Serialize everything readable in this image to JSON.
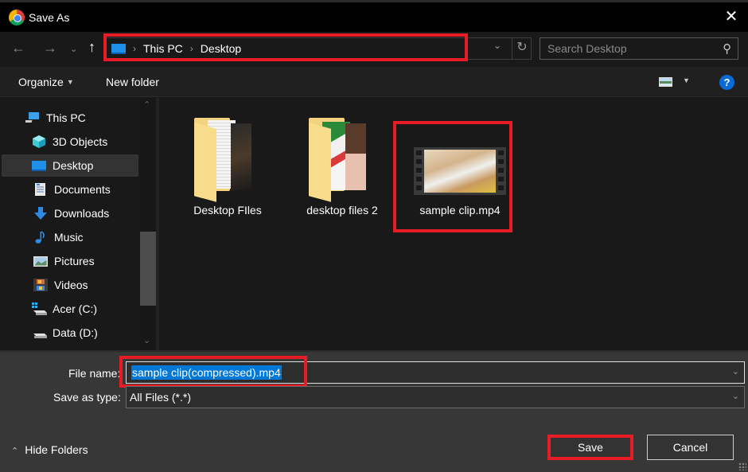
{
  "window": {
    "title": "Save As",
    "app_icon": "chrome-icon",
    "close_label": "✕"
  },
  "nav": {
    "back_icon": "←",
    "forward_icon": "→",
    "recent_icon": "⌄",
    "up_icon": "↑",
    "breadcrumb": [
      {
        "label": "This PC"
      },
      {
        "label": "Desktop"
      }
    ],
    "breadcrumb_sep": "›",
    "dropdown_icon": "⌄",
    "refresh_icon": "↻",
    "search_placeholder": "Search Desktop",
    "search_icon": "⚲"
  },
  "toolbar": {
    "organize_label": "Organize",
    "organize_caret": "▼",
    "new_folder_label": "New folder",
    "view_caret": "▼",
    "help_label": "?"
  },
  "sidebar": {
    "items": [
      {
        "label": "This PC",
        "icon": "computer-icon",
        "selected": false
      },
      {
        "label": "3D Objects",
        "icon": "cube-icon",
        "selected": false
      },
      {
        "label": "Desktop",
        "icon": "desktop-icon",
        "selected": true
      },
      {
        "label": "Documents",
        "icon": "document-icon",
        "selected": false
      },
      {
        "label": "Downloads",
        "icon": "download-arrow-icon",
        "selected": false
      },
      {
        "label": "Music",
        "icon": "music-note-icon",
        "selected": false
      },
      {
        "label": "Pictures",
        "icon": "picture-icon",
        "selected": false
      },
      {
        "label": "Videos",
        "icon": "film-icon",
        "selected": false
      },
      {
        "label": "Acer (C:)",
        "icon": "windows-drive-icon",
        "selected": false
      },
      {
        "label": "Data (D:)",
        "icon": "drive-icon",
        "selected": false
      }
    ],
    "scroll_up": "⌃",
    "scroll_down": "⌄"
  },
  "files": [
    {
      "name": "Desktop FIles",
      "type": "folder"
    },
    {
      "name": "desktop files 2",
      "type": "folder"
    },
    {
      "name": "sample clip.mp4",
      "type": "video"
    }
  ],
  "form": {
    "filename_label": "File name:",
    "filename_value": "sample clip(compressed).mp4",
    "savetype_label": "Save as type:",
    "savetype_value": "All Files (*.*)",
    "dropdown_icon": "⌄"
  },
  "footer": {
    "hide_folders_label": "Hide Folders",
    "hide_folders_icon": "⌃",
    "save_label": "Save",
    "cancel_label": "Cancel"
  },
  "colors": {
    "highlight_red": "#e81c24",
    "selection_blue": "#0078d7",
    "help_blue": "#0a6ad6"
  }
}
